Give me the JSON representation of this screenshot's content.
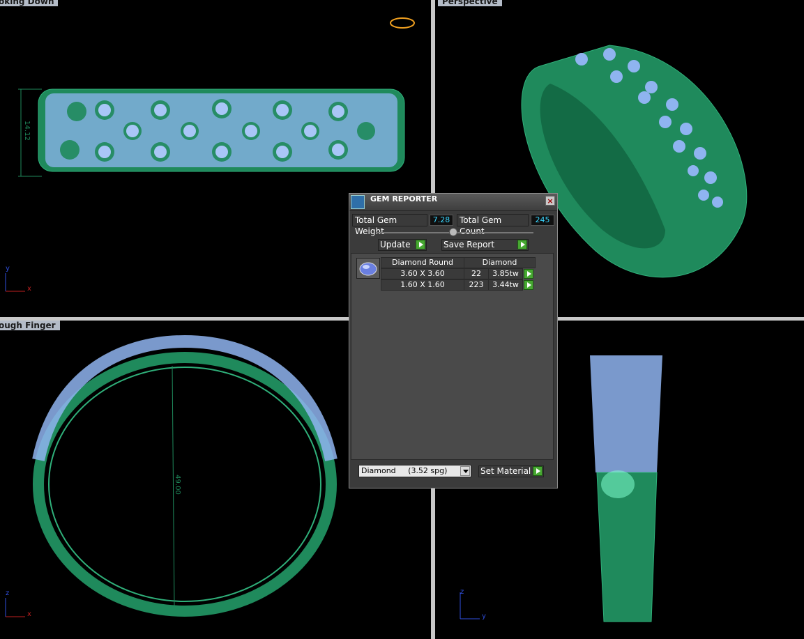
{
  "viewports": {
    "top_left": {
      "label": "oking Down",
      "dimension": "14.12"
    },
    "top_right": {
      "label": "Perspective"
    },
    "bottom_left": {
      "label": "ough Finger",
      "dimension": "49.00"
    },
    "bottom_right": {
      "label": ""
    }
  },
  "axes": {
    "top_left": {
      "up": "y",
      "right": "x"
    },
    "bottom_left": {
      "up": "z",
      "right": "x"
    },
    "bottom_right": {
      "up": "z",
      "right": "y"
    }
  },
  "dialog": {
    "title": "GEM REPORTER",
    "total_gem_weight_label": "Total Gem Weight",
    "total_gem_weight": "7.28",
    "total_gem_count_label": "Total Gem Count",
    "total_gem_count": "245",
    "update_label": "Update",
    "save_report_label": "Save Report",
    "table": {
      "header_shape": "Diamond Round",
      "header_material": "Diamond",
      "rows": [
        {
          "size": "3.60 X 3.60",
          "count": "22",
          "weight": "3.85tw"
        },
        {
          "size": "1.60 X 1.60",
          "count": "223",
          "weight": "3.44tw"
        }
      ]
    },
    "material_select": "Diamond     (3.52 spg)",
    "set_material_label": "Set Material"
  },
  "colors": {
    "metal": "#1f8a5c",
    "gem": "#8fb4f0",
    "background": "#000000",
    "accent_cyan": "#3ad6ff"
  }
}
